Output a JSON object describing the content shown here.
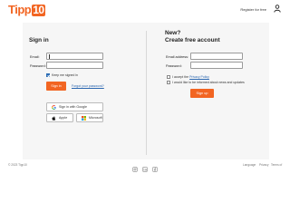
{
  "header": {
    "logo_text": "Tipp",
    "logo_number": "10",
    "register_label": "Register for free",
    "user_icon": "user-icon"
  },
  "signin": {
    "title": "Sign in",
    "email_label": "Email:",
    "email_value": "",
    "password_label": "Password:",
    "password_value": "",
    "keep_signed_in_label": "Keep me signed in",
    "keep_signed_in_checked": true,
    "sign_in_button": "Sign in",
    "forgot_password_link": "Forgot your password?",
    "google_button": "Sign in with Google",
    "apple_button": "Apple",
    "microsoft_button": "Microsoft"
  },
  "signup": {
    "title_line1": "New?",
    "title_line2": "Create free account",
    "email_label": "Email address:",
    "password_label": "Password:",
    "accept_prefix": "I accept the",
    "privacy_policy_link": "Privacy Policy",
    "news_label": "I would like to be informed about news and updates",
    "signup_button": "Sign up"
  },
  "footer": {
    "copyright": "© 2023 Tipp10",
    "language": "Language",
    "privacy": "Privacy",
    "terms": "Terms of",
    "social_icons": [
      "instagram-icon",
      "linkedin-icon",
      "facebook-icon"
    ]
  },
  "colors": {
    "accent": "#f26522",
    "checkbox": "#2d6db5",
    "link": "#2b67b0",
    "panel": "#f6f6f6"
  }
}
